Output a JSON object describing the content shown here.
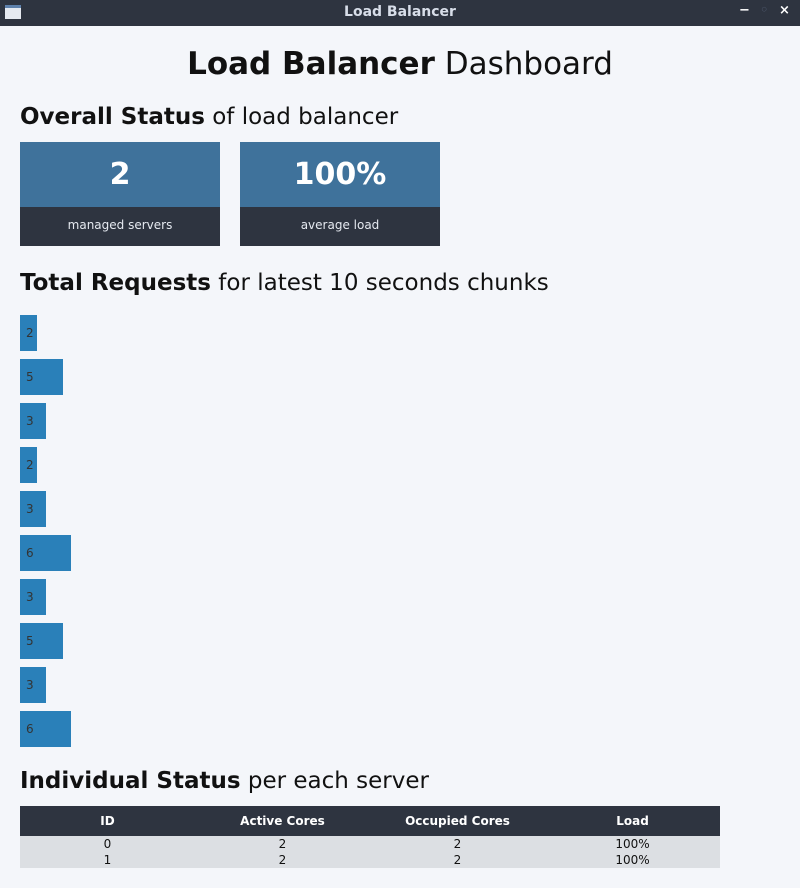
{
  "window": {
    "title": "Load Balancer",
    "minimize_glyph": "−",
    "maximize_glyph": "◦",
    "close_glyph": "×"
  },
  "header": {
    "title_bold": "Load Balancer",
    "title_light": "Dashboard"
  },
  "overall": {
    "heading_bold": "Overall Status",
    "heading_light": "of load balancer",
    "cards": [
      {
        "value": "2",
        "label": "managed servers"
      },
      {
        "value": "100%",
        "label": "average load"
      }
    ]
  },
  "requests": {
    "heading_bold": "Total Requests",
    "heading_light": "for latest 10 seconds chunks",
    "values": [
      "2",
      "5",
      "3",
      "2",
      "3",
      "6",
      "3",
      "5",
      "3",
      "6"
    ]
  },
  "individual": {
    "heading_bold": "Individual Status",
    "heading_light": "per each server",
    "columns": [
      "ID",
      "Active Cores",
      "Occupied Cores",
      "Load"
    ],
    "rows": [
      [
        "0",
        "2",
        "2",
        "100%"
      ],
      [
        "1",
        "2",
        "2",
        "100%"
      ]
    ]
  },
  "colors": {
    "titlebar": "#2e3440",
    "card_value": "#3f729b",
    "card_label": "#2e3440",
    "bar": "#2a80b9",
    "table_header": "#2e3440",
    "table_row": "#dcdfe3",
    "background": "#f4f6fa"
  }
}
